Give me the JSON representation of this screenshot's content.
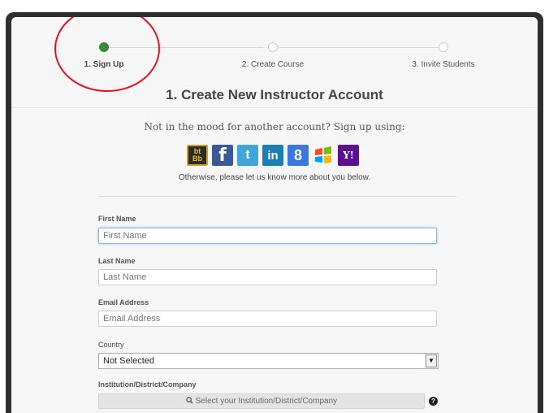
{
  "steps": [
    {
      "label": "1. Sign Up",
      "active": true
    },
    {
      "label": "2. Create Course",
      "active": false
    },
    {
      "label": "3. Invite Students",
      "active": false
    }
  ],
  "page_title": "1. Create New Instructor Account",
  "social_prompt": "Not in the mood for another account? Sign up using:",
  "social_providers": [
    {
      "icon": "blackboard-icon",
      "text_top": "bt",
      "text_bottom": "Bb"
    },
    {
      "icon": "facebook-icon",
      "text": "f"
    },
    {
      "icon": "twitter-icon",
      "text": "t"
    },
    {
      "icon": "linkedin-icon",
      "text": "in"
    },
    {
      "icon": "google-icon",
      "text": "8"
    },
    {
      "icon": "windows-live-icon"
    },
    {
      "icon": "yahoo-icon",
      "text": "Y!"
    }
  ],
  "otherwise_text": "Otherwise, please let us know more about you below.",
  "form": {
    "first_name": {
      "label": "First Name",
      "placeholder": "First Name"
    },
    "last_name": {
      "label": "Last Name",
      "placeholder": "Last Name"
    },
    "email": {
      "label": "Email Address",
      "placeholder": "Email Address"
    },
    "country": {
      "label": "Country",
      "selected": "Not Selected"
    },
    "institution": {
      "label": "Institution/District/Company",
      "button_label": "Select your Institution/District/Company"
    }
  },
  "colors": {
    "active_step": "#3b8a36",
    "annotation": "#e0141c"
  }
}
